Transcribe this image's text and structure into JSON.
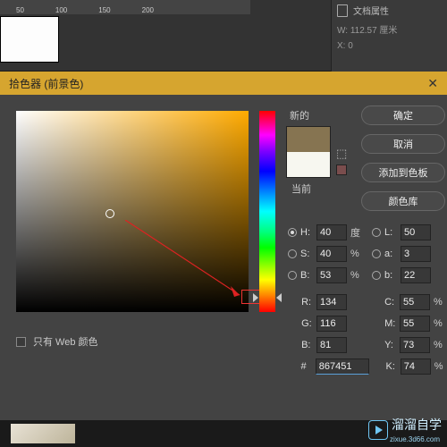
{
  "ruler": {
    "m1": "50",
    "m2": "100",
    "m3": "150",
    "m4": "200"
  },
  "panel": {
    "doc_props": "文档属性",
    "w_line": "W: 112.57 厘米",
    "x_line": "X: 0"
  },
  "dialog": {
    "title": "拾色器 (前景色)",
    "new_label": "新的",
    "current_label": "当前",
    "buttons": {
      "ok": "确定",
      "cancel": "取消",
      "add": "添加到色板",
      "lib": "颜色库"
    },
    "fields": {
      "h_lbl": "H:",
      "h_val": "40",
      "h_unit": "度",
      "s_lbl": "S:",
      "s_val": "40",
      "s_unit": "%",
      "b_lbl": "B:",
      "b_val": "53",
      "b_unit": "%",
      "l_lbl": "L:",
      "l_val": "50",
      "a_lbl": "a:",
      "a_val": "3",
      "bb_lbl": "b:",
      "bb_val": "22",
      "r_lbl": "R:",
      "r_val": "134",
      "g_lbl": "G:",
      "g_val": "116",
      "bl_lbl": "B:",
      "bl_val": "81",
      "c_lbl": "C:",
      "c_val": "55",
      "c_unit": "%",
      "m_lbl": "M:",
      "m_val": "55",
      "m_unit": "%",
      "y_lbl": "Y:",
      "y_val": "73",
      "y_unit": "%",
      "k_lbl": "K:",
      "k_val": "74",
      "k_unit": "%",
      "hex_lbl": "#",
      "hex_val": "867451"
    },
    "web_only": "只有 Web 颜色"
  },
  "brand": {
    "name": "溜溜自学",
    "url": "zixue.3d66.com"
  },
  "colors": {
    "accent": "#d6a52f",
    "new_swatch": "#867451",
    "old_swatch": "#f7f7f0"
  }
}
